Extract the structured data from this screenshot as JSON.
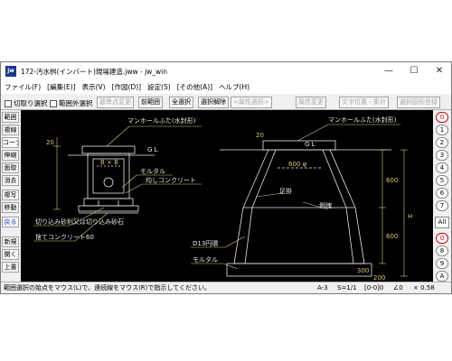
{
  "window": {
    "app_icon_text": "jw",
    "title": "172-汚水桝(インバート)現場建造.jww - jw_win",
    "minimize": "—",
    "maximize": "☐",
    "close": "✕"
  },
  "menu": [
    "ファイル(F)",
    "[編集(E)]",
    "表示(V)",
    "[作図(D)]",
    "設定(S)",
    "[その他(A)]",
    "ヘルプ(H)"
  ],
  "toolbar": {
    "chk_cut": "切取り選択",
    "chk_outside": "範囲外選択",
    "btn_base_point": "基準点変更",
    "btn_prev_range": "前範囲",
    "btn_select_all": "全選択",
    "btn_deselect": "選択解除",
    "btn_attr_select": "<属性選択>",
    "btn_attr_change": "属性変更",
    "btn_text_pos": "文字位置・集計",
    "btn_register": "選択図形登録"
  },
  "left_tools": [
    "範囲",
    "複線",
    "コーナー",
    "伸縮",
    "面取",
    "消去",
    "複写",
    "移動",
    "戻る",
    "新規",
    "開く",
    "上書"
  ],
  "right_layers": {
    "top": [
      "0",
      "1",
      "2",
      "3",
      "4",
      "5",
      "6",
      "7"
    ],
    "all": "All",
    "bottom": [
      "0",
      "8",
      "9",
      "A"
    ]
  },
  "drawing": {
    "gl_left": "G L",
    "gl_right": "G L",
    "manhole_lid_left": "マンホールふた(水封形)",
    "manhole_lid_right": "マンホールふた(水封形)",
    "dim_b": "B × B",
    "mortar_1": "モルタル",
    "precast_concrete": "均しコンクリート",
    "cut_gravel": "切り込み砂利又は切り込み砂石",
    "leveling_concrete": "捨てコンクリート60",
    "d13_rebar": "D13円環",
    "mortar_2": "モルタル",
    "ashikake": "足掛",
    "sokkai": "側塊",
    "dia_600": "600 φ",
    "dim_20": "20",
    "dim_600a": "600",
    "dim_600b": "600",
    "dim_300": "300",
    "dim_200": "200",
    "dim_h": "H"
  },
  "status": {
    "message": "範囲選択の始点をマウス(L)で、連続線をマウス(R)で指示してください。",
    "paper": "A-3",
    "scale": "S=1/1",
    "layer": "[0-0]0",
    "angle": "∠0",
    "zoom": "× 0.58"
  },
  "colors": {
    "canvas_bg": "#000000",
    "line_white": "#e8e8e8",
    "dim_gold": "#d8c878",
    "selected_layer": "#d00000"
  }
}
